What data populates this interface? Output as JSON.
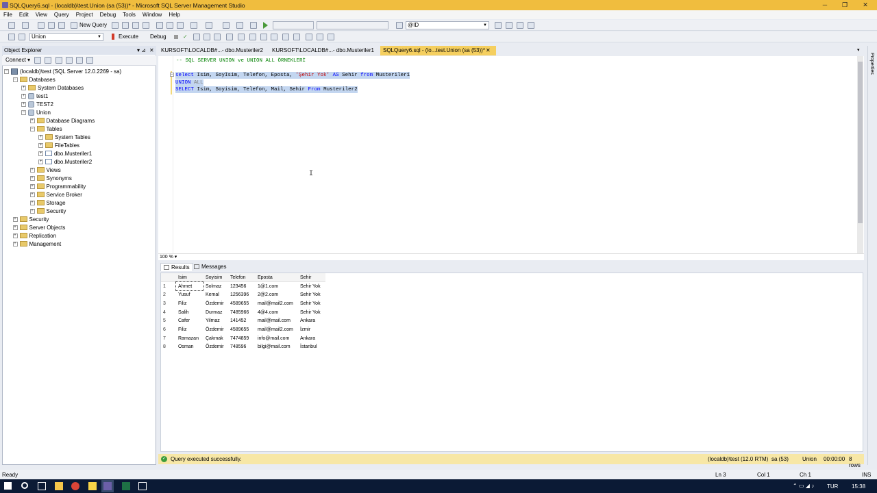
{
  "window": {
    "title": "SQLQuery6.sql - (localdb)\\test.Union (sa (53))* - Microsoft SQL Server Management Studio",
    "controls": [
      "─",
      "❐",
      "✕"
    ]
  },
  "menu": [
    "File",
    "Edit",
    "View",
    "Query",
    "Project",
    "Debug",
    "Tools",
    "Window",
    "Help"
  ],
  "toolbar": {
    "new_query": "New Query",
    "param_dropdown": "@ID",
    "db_dropdown": "Union",
    "execute": "Execute",
    "debug": "Debug"
  },
  "object_explorer": {
    "title": "Object Explorer",
    "connect": "Connect",
    "nodes": [
      {
        "label": "(localdb)\\test (SQL Server 12.0.2269 - sa)",
        "level": 0,
        "exp": "−",
        "kind": "srv"
      },
      {
        "label": "Databases",
        "level": 1,
        "exp": "−",
        "kind": "fold"
      },
      {
        "label": "System Databases",
        "level": 2,
        "exp": "+",
        "kind": "fold"
      },
      {
        "label": "test1",
        "level": 2,
        "exp": "+",
        "kind": "db"
      },
      {
        "label": "TEST2",
        "level": 2,
        "exp": "+",
        "kind": "db"
      },
      {
        "label": "Union",
        "level": 2,
        "exp": "−",
        "kind": "db"
      },
      {
        "label": "Database Diagrams",
        "level": 3,
        "exp": "+",
        "kind": "fold"
      },
      {
        "label": "Tables",
        "level": 3,
        "exp": "−",
        "kind": "fold"
      },
      {
        "label": "System Tables",
        "level": 4,
        "exp": "+",
        "kind": "fold"
      },
      {
        "label": "FileTables",
        "level": 4,
        "exp": "+",
        "kind": "fold"
      },
      {
        "label": "dbo.Musteriler1",
        "level": 4,
        "exp": "+",
        "kind": "tbl"
      },
      {
        "label": "dbo.Musteriler2",
        "level": 4,
        "exp": "+",
        "kind": "tbl"
      },
      {
        "label": "Views",
        "level": 3,
        "exp": "+",
        "kind": "fold"
      },
      {
        "label": "Synonyms",
        "level": 3,
        "exp": "+",
        "kind": "fold"
      },
      {
        "label": "Programmability",
        "level": 3,
        "exp": "+",
        "kind": "fold"
      },
      {
        "label": "Service Broker",
        "level": 3,
        "exp": "+",
        "kind": "fold"
      },
      {
        "label": "Storage",
        "level": 3,
        "exp": "+",
        "kind": "fold"
      },
      {
        "label": "Security",
        "level": 3,
        "exp": "+",
        "kind": "fold"
      },
      {
        "label": "Security",
        "level": 1,
        "exp": "+",
        "kind": "fold"
      },
      {
        "label": "Server Objects",
        "level": 1,
        "exp": "+",
        "kind": "fold"
      },
      {
        "label": "Replication",
        "level": 1,
        "exp": "+",
        "kind": "fold"
      },
      {
        "label": "Management",
        "level": 1,
        "exp": "+",
        "kind": "fold"
      }
    ]
  },
  "tabs": [
    {
      "label": "KURSOFT\\LOCALDB#...- dbo.Musteriler2",
      "active": false
    },
    {
      "label": "KURSOFT\\LOCALDB#...- dbo.Musteriler1",
      "active": false
    },
    {
      "label": "SQLQuery6.sql - (lo...test.Union (sa (53))*",
      "active": true
    }
  ],
  "tab_close": "✕",
  "editor": {
    "comment": "-- SQL SERVER UNION ve UNION ALL ÖRNEKLERİ",
    "line1": {
      "kw1": "select",
      "cols": " Isim, SoyIsim, Telefon, Eposta, ",
      "str": "'Şehir Yok'",
      "kw2": " AS ",
      "alias": "Sehir ",
      "kw3": "from",
      "table": " Musteriler1"
    },
    "line2": {
      "kw1": "UNION",
      "kw2": " ALL"
    },
    "line3": {
      "kw1": "SELECT",
      "cols": " Isim, Soyisim, Telefon, Mail, Sehir ",
      "kw2": "From",
      "table": " Musteriler2"
    }
  },
  "zoom": "100 %",
  "result_tabs": [
    "Results",
    "Messages"
  ],
  "results": {
    "columns": [
      "Isim",
      "Soyisim",
      "Telefon",
      "Eposta",
      "Sehir"
    ],
    "rows": [
      [
        "1",
        "Ahmet",
        "Solmaz",
        "123456",
        "1@1.com",
        "Sehir Yok"
      ],
      [
        "2",
        "Yusuf",
        "Kemal",
        "1256396",
        "2@2.com",
        "Sehir Yok"
      ],
      [
        "3",
        "Filiz",
        "Özdemir",
        "4589655",
        "mail@mail2.com",
        "Sehir Yok"
      ],
      [
        "4",
        "Salih",
        "Durmaz",
        "7485966",
        "4@4.com",
        "Sehir Yok"
      ],
      [
        "5",
        "Cafer",
        "Yilmaz",
        "141452",
        "mail@mail.com",
        "Ankara"
      ],
      [
        "6",
        "Filiz",
        "Özdemir",
        "4589655",
        "mail@mail2.com",
        "İzmir"
      ],
      [
        "7",
        "Ramazan",
        "Çakmak",
        "7474859",
        "info@mail.com",
        "Ankara"
      ],
      [
        "8",
        "Osman",
        "Özdemir",
        "748596",
        "bilgi@mail.com",
        "İstanbul"
      ]
    ]
  },
  "query_status": {
    "message": "Query executed successfully.",
    "server": "(localdb)\\test (12.0 RTM)",
    "user": "sa (53)",
    "db": "Union",
    "time": "00:00:00",
    "rows": "8 rows"
  },
  "statusbar": {
    "ready": "Ready",
    "ln": "Ln 3",
    "col": "Col 1",
    "ch": "Ch 1",
    "ins": "INS"
  },
  "right_panel": "Properties",
  "taskbar": {
    "lang": "TUR",
    "time": "15:38"
  },
  "colors": {
    "accent": "#f0bd3e",
    "active_tab": "#f5cf5f",
    "status_bg": "#f7e7a6",
    "keyword": "#0000ff",
    "string": "#c00000",
    "comment": "#008000"
  }
}
